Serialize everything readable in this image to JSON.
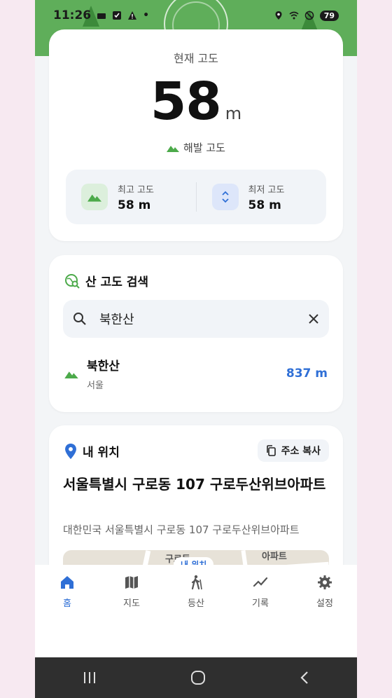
{
  "status": {
    "time": "11:26",
    "dot": "•",
    "battery": "79"
  },
  "altitude": {
    "label": "현재 고도",
    "value": "58",
    "unit": "m",
    "subtitle": "해발 고도",
    "max_label": "최고 고도",
    "max_value": "58 m",
    "min_label": "최저 고도",
    "min_value": "58 m"
  },
  "search": {
    "title": "산 고도 검색",
    "query": "북한산",
    "results": [
      {
        "name": "북한산",
        "region": "서울",
        "elevation": "837 m"
      }
    ]
  },
  "location": {
    "title": "내 위치",
    "copy_label": "주소 복사",
    "address": "서울특별시 구로동 107 구로두산위브아파트",
    "full_address": "대한민국 서울특별시 구로동 107 구로두산위브아파트",
    "map_label_1": "구로동",
    "map_label_2": "아파트",
    "map_pill": "내 위치"
  },
  "nav": {
    "items": [
      {
        "label": "홈",
        "icon": "home-icon"
      },
      {
        "label": "지도",
        "icon": "map-icon"
      },
      {
        "label": "등산",
        "icon": "hiking-icon"
      },
      {
        "label": "기록",
        "icon": "trend-icon"
      },
      {
        "label": "설정",
        "icon": "gear-icon"
      }
    ]
  },
  "colors": {
    "accent": "#2f6fd6",
    "green": "#4caa4a",
    "header": "#5fae5a"
  }
}
